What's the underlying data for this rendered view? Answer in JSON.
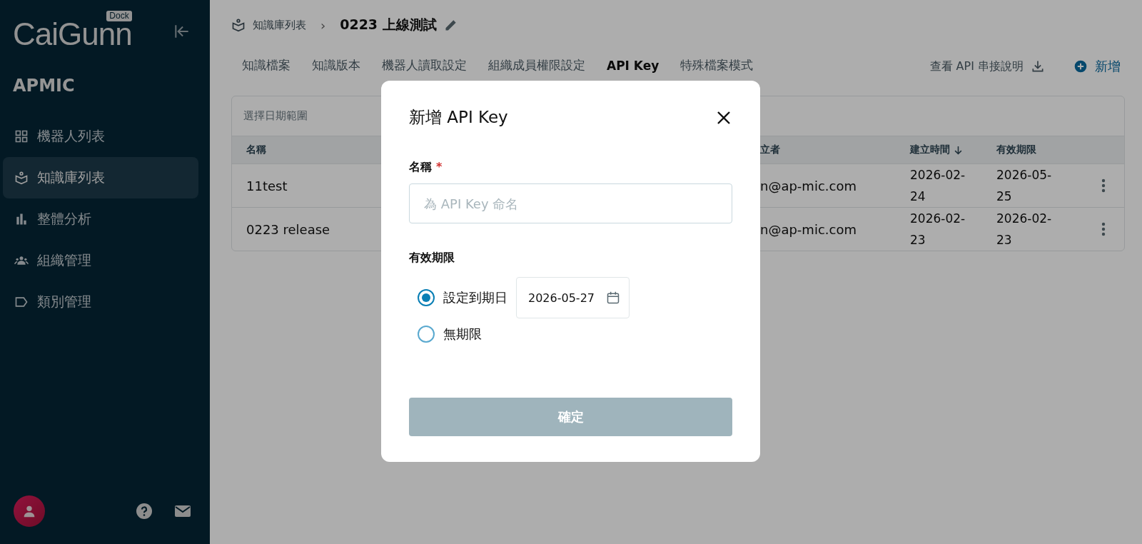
{
  "sidebar": {
    "logo": "CaiGunn",
    "logo_badge": "Dock",
    "org": "APMIC",
    "items": [
      {
        "label": "機器人列表",
        "selected": false
      },
      {
        "label": "知識庫列表",
        "selected": true
      },
      {
        "label": "整體分析",
        "selected": false
      },
      {
        "label": "組織管理",
        "selected": false
      },
      {
        "label": "類別管理",
        "selected": false
      }
    ]
  },
  "breadcrumb": {
    "parent": "知識庫列表",
    "separator": "›",
    "title": "0223 上線測試"
  },
  "tabs": [
    {
      "label": "知識檔案",
      "selected": false
    },
    {
      "label": "知識版本",
      "selected": false
    },
    {
      "label": "機器人讀取設定",
      "selected": false
    },
    {
      "label": "組織成員權限設定",
      "selected": false
    },
    {
      "label": "API Key",
      "selected": true
    },
    {
      "label": "特殊檔案模式",
      "selected": false
    }
  ],
  "actions": {
    "doc_link": "查看 API 串接說明",
    "add_button": "新增"
  },
  "table": {
    "filter_placeholder": "選擇日期範圍",
    "columns": [
      {
        "label": "名稱",
        "sorted": false
      },
      {
        "label": "立者",
        "sorted": false
      },
      {
        "label": "建立時間",
        "sorted": true
      },
      {
        "label": "有效期限",
        "sorted": false
      }
    ],
    "rows": [
      {
        "cells": [
          "11test",
          "n@ap-mic.com",
          "2026-02-24",
          "2026-05-25"
        ]
      },
      {
        "cells": [
          "0223 release",
          "n@ap-mic.com",
          "2026-02-23",
          "2026-02-23"
        ]
      }
    ]
  },
  "dialog": {
    "title": "新增 API Key",
    "name_label": "名稱",
    "required_mark": "*",
    "name_placeholder": "為 API Key 命名",
    "expiry_label": "有效期限",
    "options": [
      {
        "label": "設定到期日",
        "selected": true,
        "date": "2026-05-27"
      },
      {
        "label": "無期限",
        "selected": false
      }
    ],
    "confirm": {
      "label": "確定",
      "disabled": true
    }
  }
}
